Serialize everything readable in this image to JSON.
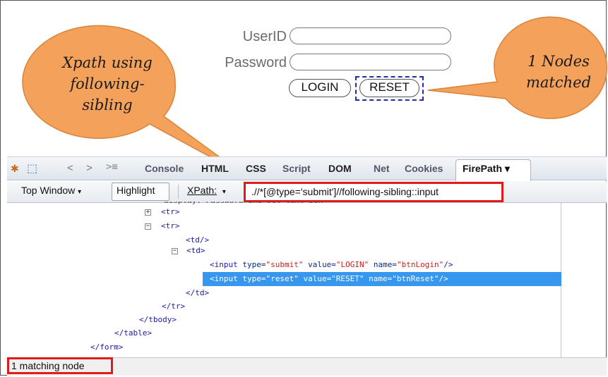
{
  "login_form": {
    "userid_label": "UserID",
    "password_label": "Password",
    "login_button": "LOGIN",
    "reset_button": "RESET"
  },
  "callouts": {
    "left": [
      "Xpath using",
      "following-",
      "sibling"
    ],
    "right": [
      "1 Nodes",
      "matched"
    ]
  },
  "colors": {
    "callout_fill": "#f4a25b",
    "callout_stroke": "#d9833a",
    "highlight_red": "#e01b1b",
    "selection_blue": "#3797ee",
    "dashed_focus": "#1d2fa8"
  },
  "firebug": {
    "tabs": [
      "Console",
      "HTML",
      "CSS",
      "Script",
      "DOM",
      "Net",
      "Cookies"
    ],
    "active_tab": "FirePath ▾",
    "toolbar": {
      "top_window": "Top Window",
      "highlight": "Highlight",
      "xpath_label": "XPath:",
      "xpath_value": ".//*[@type='submit']//following-sibling::input"
    },
    "tree": {
      "truncated_line": "display: Password and set text box",
      "lines": [
        "<tr>",
        "<tr>",
        "<td/>",
        "<td>",
        "</td>",
        "</tr>",
        "</tbody>",
        "</table>",
        "</form>"
      ],
      "input1": {
        "tag": "<input",
        "type_attr": "type=",
        "type_val": "\"submit\"",
        "value_attr": "value=",
        "value_val": "\"LOGIN\"",
        "name_attr": "name=",
        "name_val": "\"btnLogin\"",
        "close": "/>"
      },
      "input2": "<input type=\"reset\" value=\"RESET\" name=\"btnReset\"/>"
    },
    "status": "1 matching node"
  }
}
